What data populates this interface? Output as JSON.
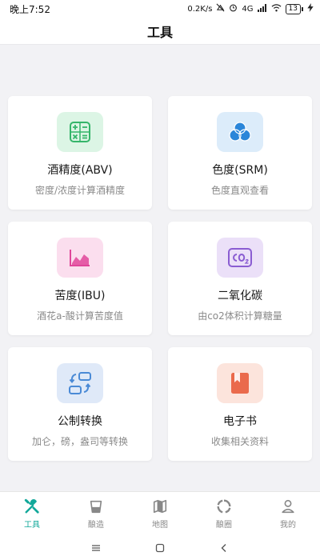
{
  "statusbar": {
    "time": "晚上7:52",
    "speed": "0.2K/s",
    "network": "4G",
    "battery": "13"
  },
  "header": {
    "title": "工具"
  },
  "tools": [
    {
      "title": "酒精度(ABV)",
      "subtitle": "密度/浓度计算酒精度",
      "icon": "calculator-icon",
      "color": "#35b56a",
      "bg": "#dcf5e5"
    },
    {
      "title": "色度(SRM)",
      "subtitle": "色度直观查看",
      "icon": "color-circles-icon",
      "color": "#2b86d9",
      "bg": "#dcecfa"
    },
    {
      "title": "苦度(IBU)",
      "subtitle": "酒花a-酸计算苦度值",
      "icon": "line-chart-icon",
      "color": "#e0469a",
      "bg": "#fbdeee"
    },
    {
      "title": "二氧化碳",
      "subtitle": "由co2体积计算糖量",
      "icon": "co2-icon",
      "color": "#8a5dd2",
      "bg": "#ebe0f8"
    },
    {
      "title": "公制转换",
      "subtitle": "加仑，磅，盎司等转换",
      "icon": "convert-icon",
      "color": "#4a8ad6",
      "bg": "#dfe9f8"
    },
    {
      "title": "电子书",
      "subtitle": "收集相关资料",
      "icon": "book-icon",
      "color": "#ea6a4c",
      "bg": "#fce4dc"
    }
  ],
  "tabs": [
    {
      "label": "工具",
      "icon": "tools-icon",
      "active": true
    },
    {
      "label": "酿造",
      "icon": "brew-icon",
      "active": false
    },
    {
      "label": "地图",
      "icon": "map-icon",
      "active": false
    },
    {
      "label": "酿圈",
      "icon": "circle-icon",
      "active": false
    },
    {
      "label": "我的",
      "icon": "user-icon",
      "active": false
    }
  ],
  "colors": {
    "accent": "#12a89a",
    "inactive": "#888888"
  }
}
